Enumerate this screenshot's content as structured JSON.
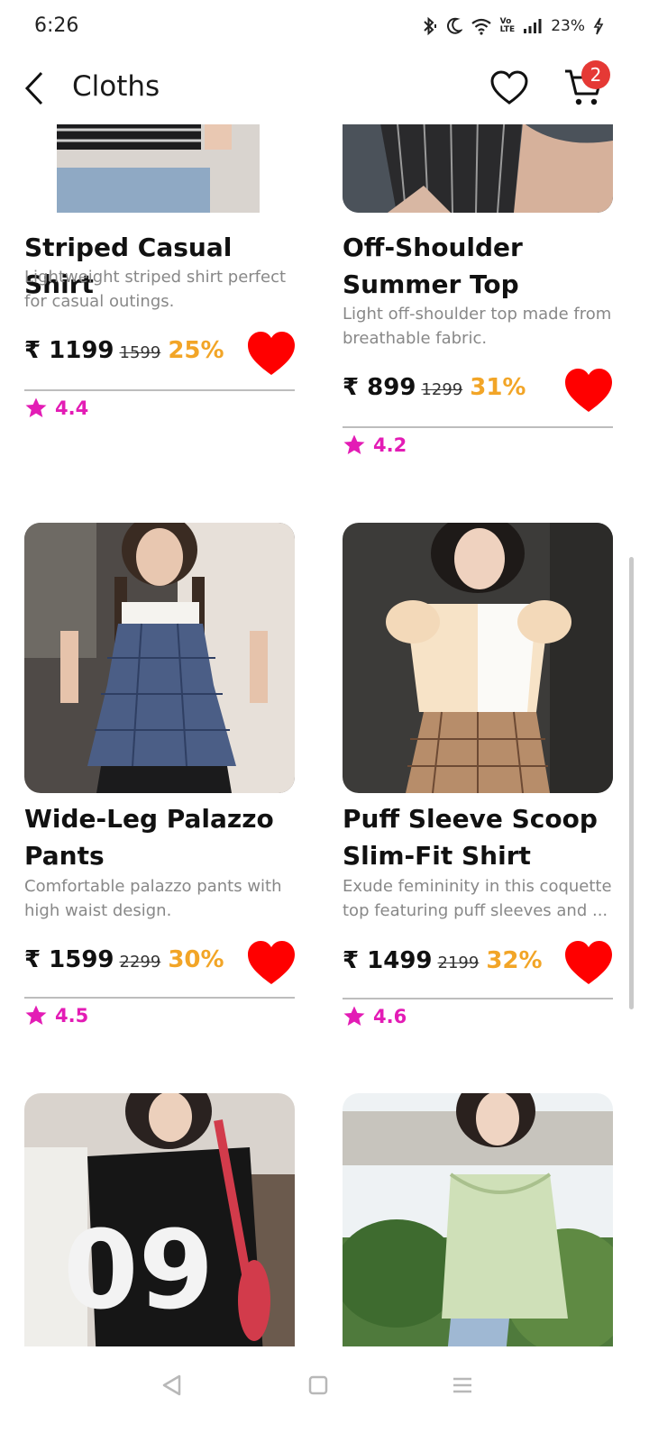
{
  "status": {
    "time": "6:26",
    "battery": "23%",
    "lte_top": "Vo",
    "lte_bottom": "LTE"
  },
  "header": {
    "title": "Cloths",
    "cart_count": "2"
  },
  "icons": {
    "back": "chevron-left-icon",
    "wishlist": "heart-outline-icon",
    "cart": "cart-icon",
    "favorite": "heart-filled-icon",
    "rating": "star-icon"
  },
  "colors": {
    "discount": "#f2a527",
    "rating": "#e31cb5",
    "heart": "#ff0000",
    "badge": "#e53935"
  },
  "products": [
    {
      "name": "Striped Casual Shirt",
      "description": "Lightweight striped shirt perfect for casual outings.",
      "price": "₹ 1199",
      "old_price": "1599",
      "discount": "25%",
      "rating": "4.4"
    },
    {
      "name": "Off-Shoulder Summer Top",
      "description": "Light off-shoulder top made from breathable fabric.",
      "price": "₹ 899",
      "old_price": "1299",
      "discount": "31%",
      "rating": "4.2"
    },
    {
      "name": "Wide-Leg Palazzo Pants",
      "description": "Comfortable palazzo pants with high waist design.",
      "price": "₹ 1599",
      "old_price": "2299",
      "discount": "30%",
      "rating": "4.5"
    },
    {
      "name": "Puff Sleeve Scoop Slim-Fit Shirt",
      "description": "Exude femininity in this coquette top featuring puff sleeves and ...",
      "price": "₹ 1499",
      "old_price": "2199",
      "discount": "32%",
      "rating": "4.6"
    },
    {
      "name": "",
      "description": "",
      "price": "",
      "old_price": "",
      "discount": "",
      "rating": ""
    },
    {
      "name": "",
      "description": "",
      "price": "",
      "old_price": "",
      "discount": "",
      "rating": ""
    }
  ]
}
